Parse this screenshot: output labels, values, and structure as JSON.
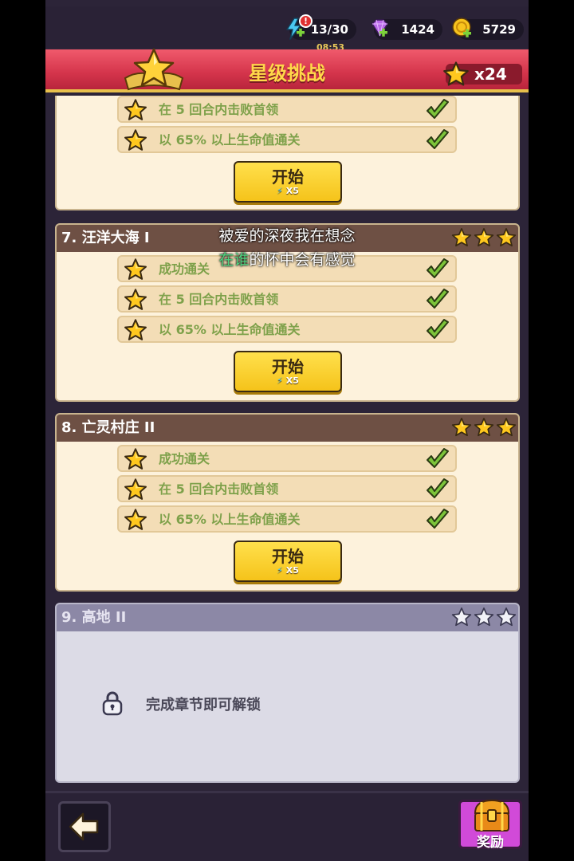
{
  "resources": {
    "energy": "13/30",
    "energy_timer": "08:53",
    "energy_alert": "!",
    "gems": "1424",
    "coins": "5729"
  },
  "header": {
    "title": "星级挑战",
    "star_total": "x24"
  },
  "stages": [
    {
      "partial": true,
      "objectives": [
        "在 5 回合内击败首领",
        "以 65% 以上生命值通关"
      ],
      "start_label": "开始",
      "start_cost": "X5"
    },
    {
      "name": "7. 汪洋大海 I",
      "stars_earned": 3,
      "objectives": [
        "成功通关",
        "在 5 回合内击败首领",
        "以 65% 以上生命值通关"
      ],
      "start_label": "开始",
      "start_cost": "X5"
    },
    {
      "name": "8. 亡灵村庄 II",
      "stars_earned": 3,
      "objectives": [
        "成功通关",
        "在 5 回合内击败首领",
        "以 65% 以上生命值通关"
      ],
      "start_label": "开始",
      "start_cost": "X5"
    },
    {
      "name": "9. 高地 II",
      "stars_earned": 0,
      "locked": true,
      "lock_text": "完成章节即可解锁"
    }
  ],
  "lyrics": {
    "line1": "被爱的深夜我在想念",
    "line2_highlight": "在谁",
    "line2_rest": "的怀中会有感觉"
  },
  "footer": {
    "rewards_label": "奖励"
  },
  "colors": {
    "star_gold": "#ffc81e",
    "check_green": "#7cc43a",
    "objective_text": "#7ea14a",
    "banner_red": "#d4344b"
  }
}
